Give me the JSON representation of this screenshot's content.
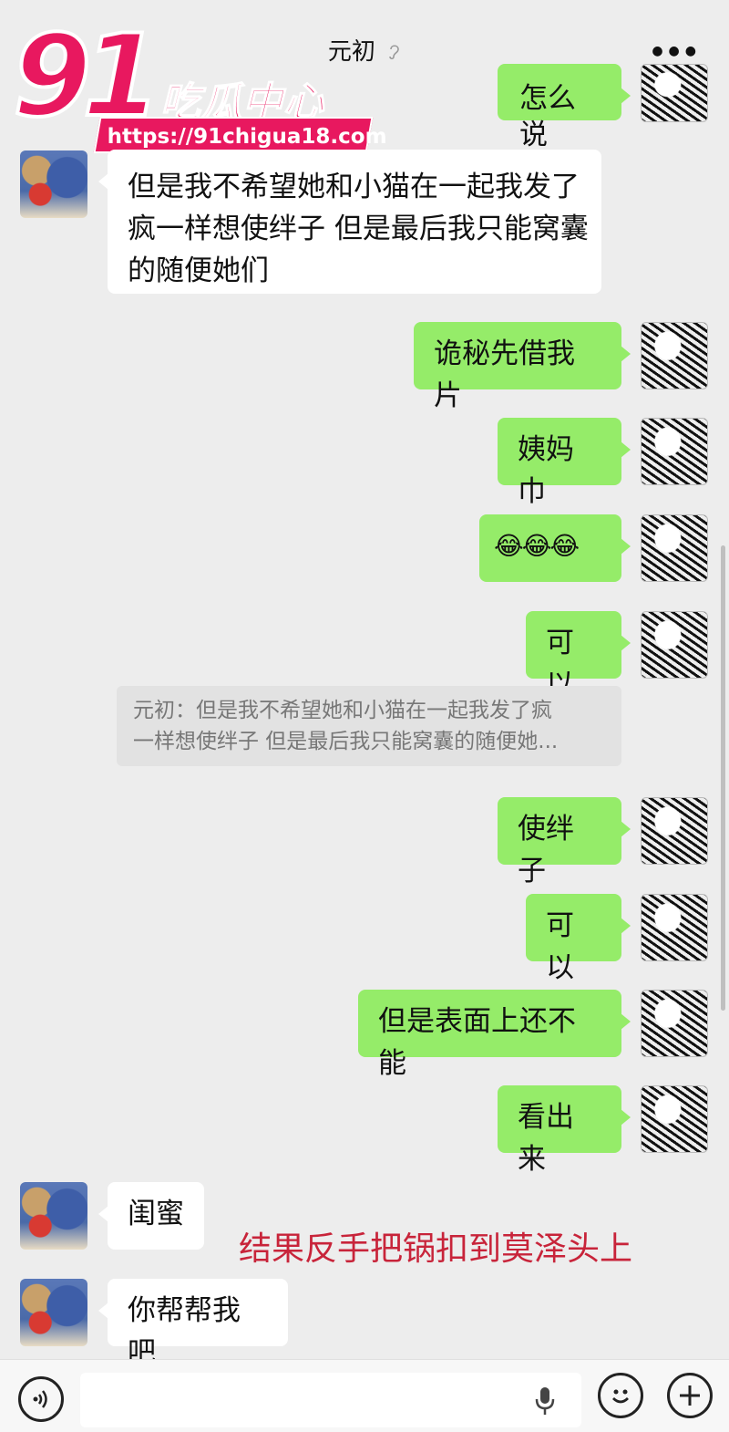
{
  "header": {
    "title": "元初",
    "more_icon": "more-dots-icon",
    "mute_icon": "ear-mute-icon"
  },
  "watermark": {
    "number": "91",
    "text": "吃瓜中心",
    "url": "https://91chigua18.com",
    "color": "#e8185f"
  },
  "messages": {
    "m0": "怎么说",
    "m1_line1": "但是我不希望她和小猫在一起我发了",
    "m1_line2": "疯一样想使绊子 但是最后我只能窝囊",
    "m1_line3": "的随便她们",
    "m2": "诡秘先借我片",
    "m3": "姨妈巾",
    "m4": "😂😂😂",
    "m5": "可以",
    "quote_line1": "元初：但是我不希望她和小猫在一起我发了疯",
    "quote_line2": "一样想使绊子 但是最后我只能窝囊的随便她...",
    "m6": "使绊子",
    "m7": "可以",
    "m8": "但是表面上还不能",
    "m9": "看出来",
    "m10": "闺蜜",
    "m11": "你帮帮我吧"
  },
  "annotation": "结果反手把锅扣到莫泽头上",
  "colors": {
    "background": "#ededed",
    "sent_bubble": "#95ec69",
    "received_bubble": "#ffffff",
    "annotation": "#c8243a"
  },
  "bottombar": {
    "voice_icon": "voice-mode-icon",
    "mic_icon": "microphone-icon",
    "emoji_icon": "emoji-icon",
    "plus_icon": "plus-icon"
  }
}
